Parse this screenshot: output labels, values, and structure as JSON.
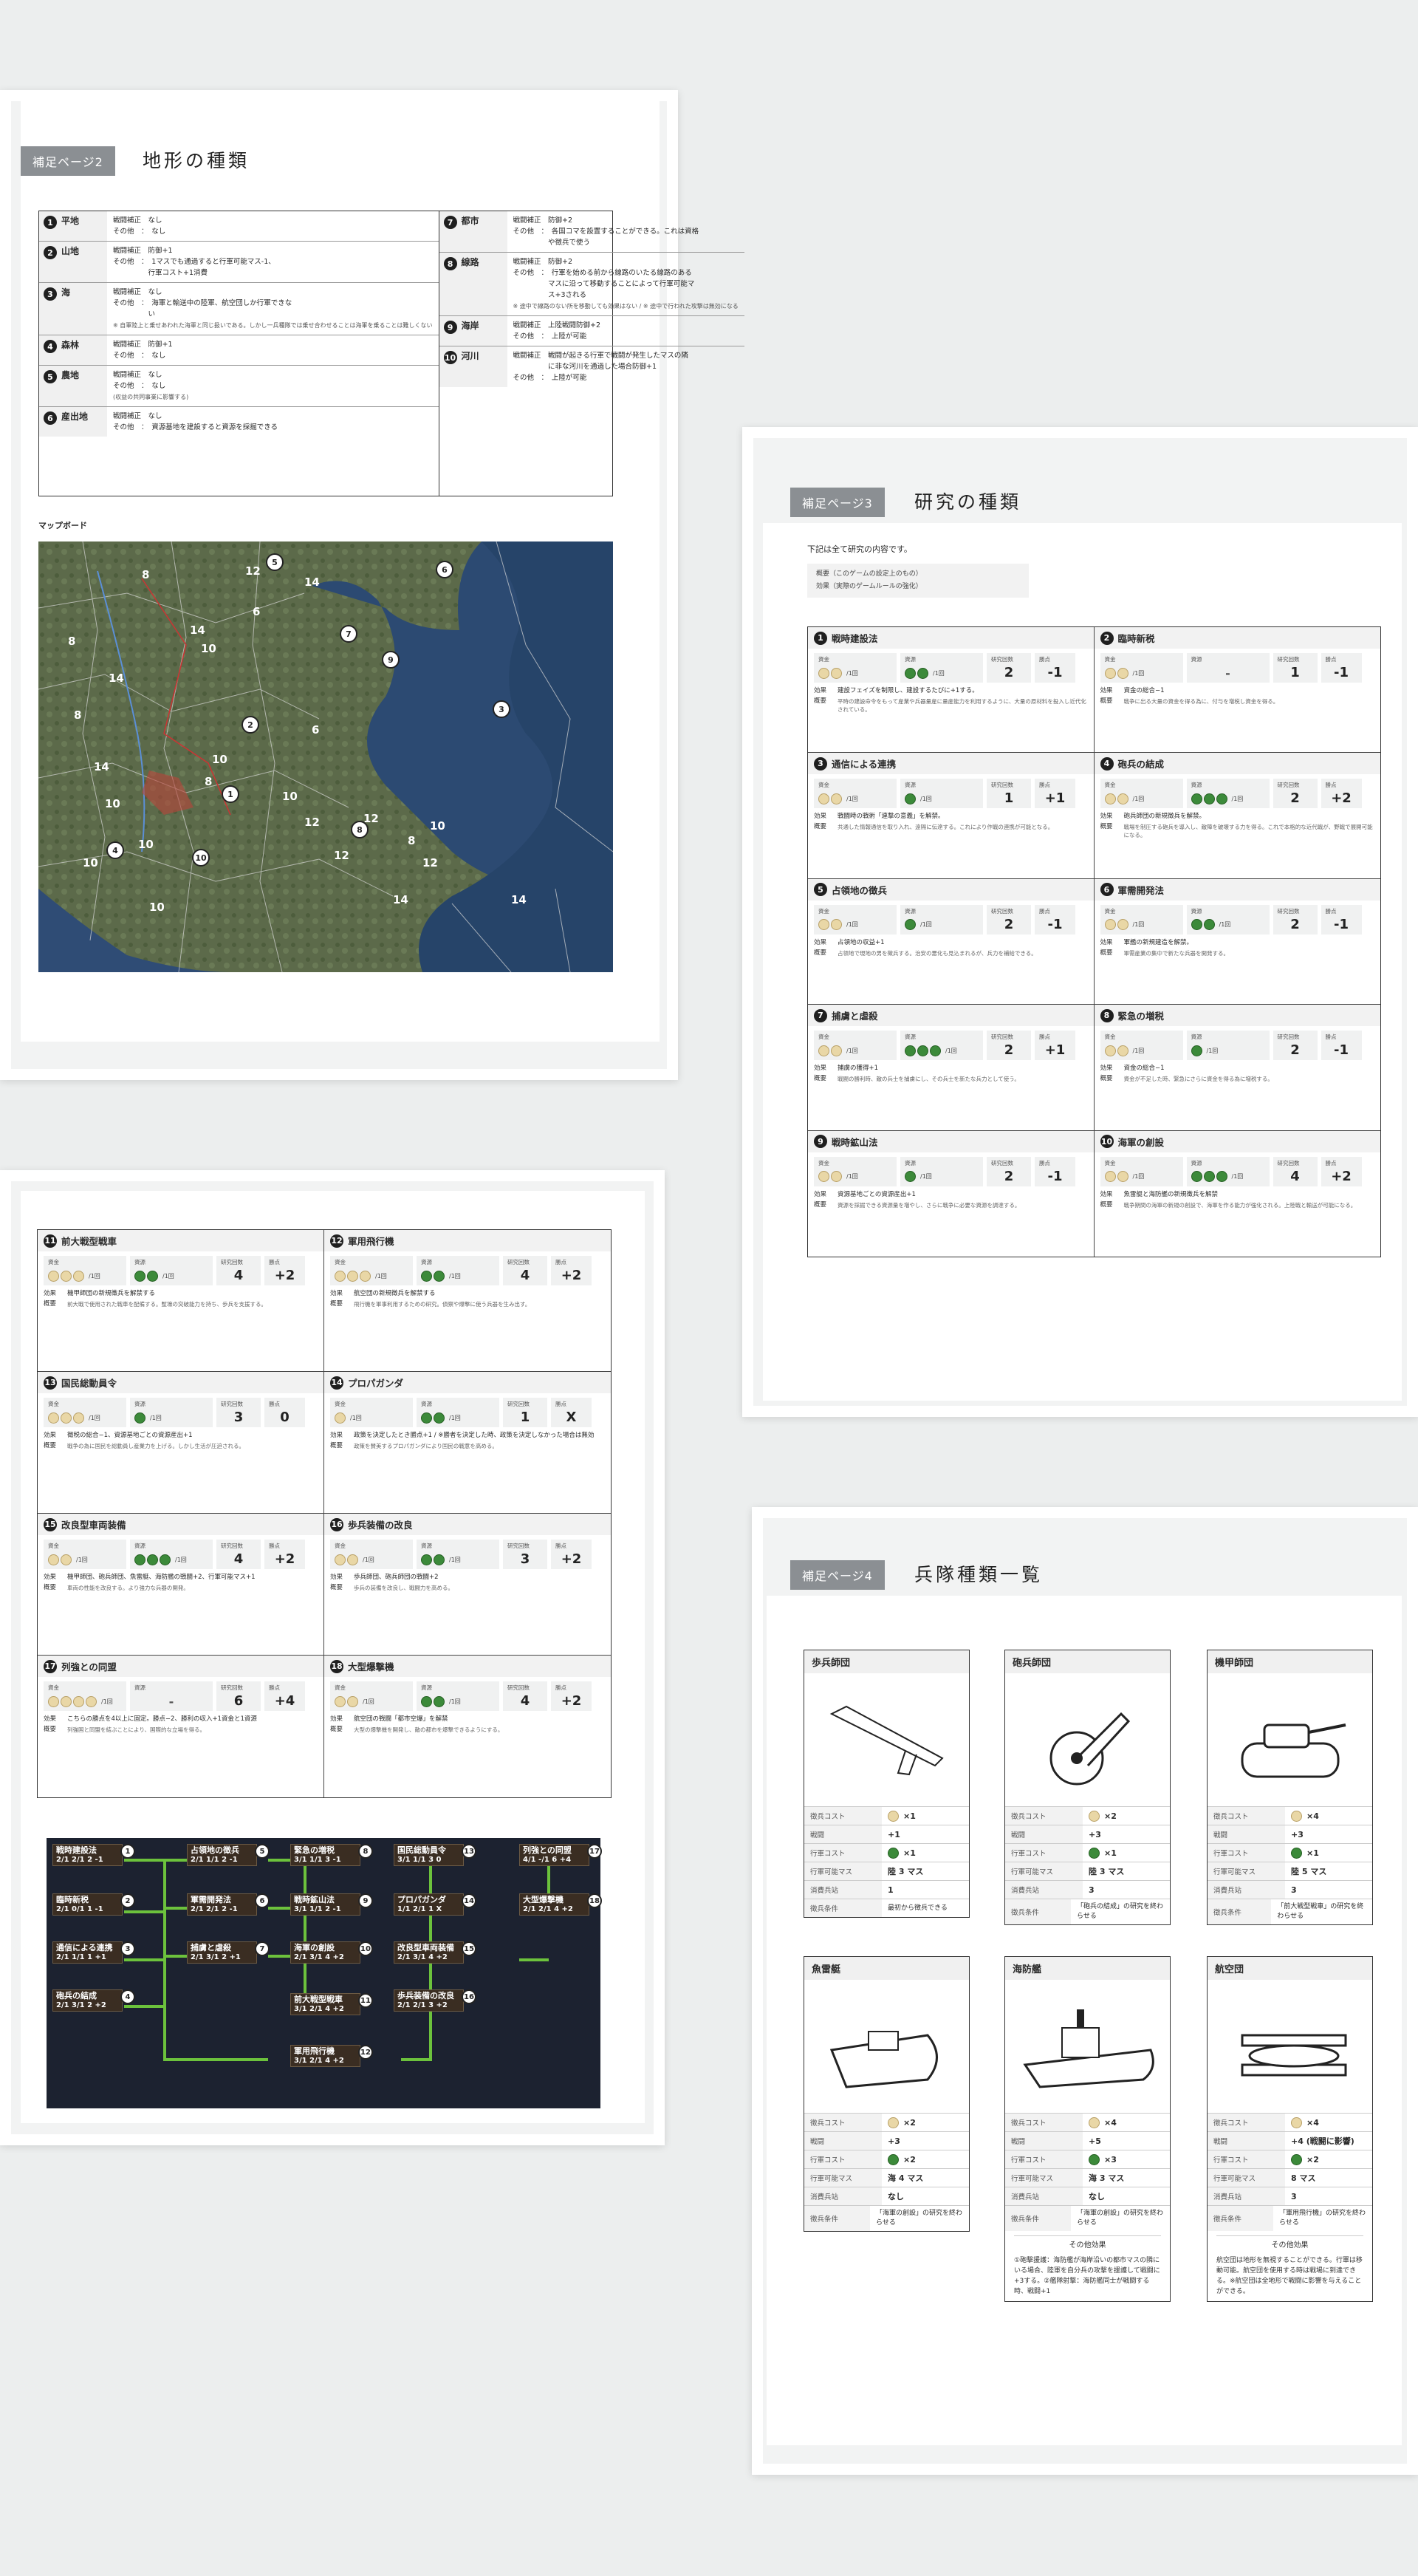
{
  "p2": {
    "badge": "補足ページ2",
    "title": "地形の種類",
    "terrain_left": [
      {
        "num": "1",
        "name": "平地",
        "lines": [
          "戦闘補正　なし",
          "その他　：　なし"
        ]
      },
      {
        "num": "2",
        "name": "山地",
        "lines": [
          "戦闘補正　防御+1",
          "その他　：　1マスでも通過すると行軍可能マス-1、",
          "　　　　　行軍コスト+1消費"
        ]
      },
      {
        "num": "3",
        "name": "海",
        "lines": [
          "戦闘補正　なし",
          "その他　：　海軍と輸送中の陸軍、航空団しか行軍できな",
          "　　　　　い"
        ],
        "note": "※ 自軍陸上と乗せあわれた海軍と同じ扱いである。しかし一兵種隊では乗せ合わせることは海軍を乗ることは難しくない"
      },
      {
        "num": "4",
        "name": "森林",
        "lines": [
          "戦闘補正　防御+1",
          "その他　：　なし"
        ]
      },
      {
        "num": "5",
        "name": "農地",
        "lines": [
          "戦闘補正　なし",
          "その他　：　なし"
        ],
        "note": "(収益の共同事業に影響する)"
      },
      {
        "num": "6",
        "name": "産出地",
        "lines": [
          "戦闘補正　なし",
          "その他　：　資源基地を建設すると資源を採掘できる"
        ]
      }
    ],
    "terrain_right": [
      {
        "num": "7",
        "name": "都市",
        "lines": [
          "戦闘補正　防御+2",
          "その他　：　各国コマを設置することができる。これは資格",
          "　　　　　や徴兵で使う"
        ]
      },
      {
        "num": "8",
        "name": "線路",
        "lines": [
          "戦闘補正　防御+2",
          "その他　：　行軍を始める前から線路のいたる線路のある",
          "　　　　　マスに沿って移動することによって行軍可能マ",
          "　　　　　ス+3される"
        ],
        "note": "※ 途中で線路のない所を移動しても効果はない / ※ 途中で行われた攻撃は無効になる"
      },
      {
        "num": "9",
        "name": "海岸",
        "lines": [
          "戦闘補正　上陸戦闘防御+2",
          "その他　：　上陸が可能"
        ]
      },
      {
        "num": "10",
        "name": "河川",
        "lines": [
          "戦闘補正　戦闘が起きる行軍で戦闘が発生したマスの隣",
          "　　　　　に非な河川を通過した場合防御+1",
          "その他　：　上陸が可能"
        ]
      }
    ],
    "map_label": "マップボード",
    "map_markers": [
      "1",
      "2",
      "3",
      "4",
      "5",
      "6",
      "7",
      "8",
      "9",
      "10"
    ],
    "map_numbers": [
      "8",
      "12",
      "6",
      "14",
      "14",
      "8",
      "10",
      "14",
      "8",
      "6",
      "10",
      "14",
      "8",
      "10",
      "10",
      "12",
      "12",
      "10",
      "8",
      "10",
      "12",
      "10",
      "12",
      "14",
      "10",
      "14"
    ]
  },
  "p3": {
    "badge": "補足ページ3",
    "title": "研究の種類",
    "intro": "下記は全て研究の内容です。",
    "legend": [
      "概要（このゲームの設定上のもの）",
      "効果（実際のゲームルールの強化）"
    ],
    "labels": {
      "fund": "資金",
      "resource": "資源",
      "turns": "研究回数",
      "vp": "勝点",
      "per": "/1回",
      "effect": "効果",
      "overview": "概要"
    },
    "items": [
      {
        "num": "1",
        "name": "戦時建設法",
        "coins": 2,
        "gems": 2,
        "turns": "2",
        "vp": "-1",
        "effect": "建設フェイズを制限し、建設するたびに+1する。",
        "overview": "平時の建設命令をもって産業や兵器量産に量産能力を利用するように、大量の原材料を投入し近代化されている。"
      },
      {
        "num": "2",
        "name": "臨時新税",
        "coins": 2,
        "gems": 0,
        "res_text": "-",
        "turns": "1",
        "vp": "-1",
        "effect": "資金の総合−1",
        "overview": "戦争に出る大量の資金を得る為に、付与を増税し資金を得る。"
      },
      {
        "num": "3",
        "name": "通信による連携",
        "coins": 2,
        "gems": 1,
        "turns": "1",
        "vp": "+1",
        "effect": "戦闘時の戦術「連撃の意義」を解禁。",
        "overview": "共通した情報通信を取り入れ、遠隔に伝達する。これにより作戦の連携が可能となる。"
      },
      {
        "num": "4",
        "name": "砲兵の結成",
        "coins": 2,
        "gems": 3,
        "turns": "2",
        "vp": "+2",
        "effect": "砲兵師団の新規徴兵を解禁。",
        "overview": "戦場を制圧する砲兵を導入し、敵陣を破壊する力を得る。これで本格的な近代戦が、野戦で展開可能になる。"
      },
      {
        "num": "5",
        "name": "占領地の徴兵",
        "coins": 2,
        "gems": 1,
        "turns": "2",
        "vp": "-1",
        "effect": "占領地の収益+1",
        "overview": "占領地で現地の男を徴兵する。治安の悪化も見込まれるが、兵力を補給できる。"
      },
      {
        "num": "6",
        "name": "軍需開発法",
        "coins": 2,
        "gems": 2,
        "turns": "2",
        "vp": "-1",
        "effect": "軍艦の新規建造を解禁。",
        "overview": "軍需産業の集中で新たな兵器を開発する。"
      },
      {
        "num": "7",
        "name": "捕虜と虐殺",
        "coins": 2,
        "gems": 3,
        "turns": "2",
        "vp": "+1",
        "effect": "捕虜の獲得+1",
        "overview": "戦闘の勝利時、敵の兵士を捕虜にし、その兵士を新たな兵力として使う。"
      },
      {
        "num": "8",
        "name": "緊急の増税",
        "coins": 2,
        "gems": 1,
        "turns": "2",
        "vp": "-1",
        "effect": "資金の総合−1",
        "overview": "資金が不足した時、緊急にさらに資金を得る為に増税する。"
      },
      {
        "num": "9",
        "name": "戦時鉱山法",
        "coins": 2,
        "gems": 1,
        "turns": "2",
        "vp": "-1",
        "effect": "資源基地ごとの資源産出+1",
        "overview": "資源を採掘できる資源量を増やし、さらに戦争に必要な資源を調達する。"
      },
      {
        "num": "10",
        "name": "海軍の創設",
        "coins": 2,
        "gems": 3,
        "turns": "4",
        "vp": "+2",
        "effect": "魚雷艇と海防艦の新規徴兵を解禁",
        "overview": "戦争期間の海軍の新規の創設で、海軍を作る能力が強化される。上陸戦と輸送が可能になる。"
      }
    ]
  },
  "p5": {
    "items": [
      {
        "num": "11",
        "name": "前大戦型戦車",
        "coins": 3,
        "gems": 2,
        "turns": "4",
        "vp": "+2",
        "effect": "機甲師団の新規徴兵を解禁する",
        "overview": "前大戦で使用された戦車を配備する。塹壕の突破能力を持ち、歩兵を支援する。"
      },
      {
        "num": "12",
        "name": "軍用飛行機",
        "coins": 3,
        "gems": 2,
        "turns": "4",
        "vp": "+2",
        "effect": "航空団の新規徴兵を解禁する",
        "overview": "飛行機を軍事利用するための研究。偵察や爆撃に使う兵器を生み出す。"
      },
      {
        "num": "13",
        "name": "国民総動員令",
        "coins": 3,
        "gems": 1,
        "turns": "3",
        "vp": "0",
        "effect": "徴税の総合−1、資源基地ごとの資源産出+1",
        "overview": "戦争の為に国民を総動員し産業力を上げる。しかし生活が圧迫される。"
      },
      {
        "num": "14",
        "name": "プロパガンダ",
        "coins": 1,
        "gems": 2,
        "turns": "1",
        "vp": "X",
        "effect": "政策を決定したとき勝点+1 / ※勝者を決定した時、政策を決定しなかった場合は無効",
        "overview": "政策を賛美するプロパガンダにより国民の戦意を高める。"
      },
      {
        "num": "15",
        "name": "改良型車両装備",
        "coins": 2,
        "gems": 3,
        "turns": "4",
        "vp": "+2",
        "effect": "機甲師団、砲兵師団、魚雷艇、海防艦の戦闘+2、行軍可能マス+1",
        "overview": "車両の性能を改良する。より強力な兵器の開発。"
      },
      {
        "num": "16",
        "name": "歩兵装備の改良",
        "coins": 2,
        "gems": 2,
        "turns": "3",
        "vp": "+2",
        "effect": "歩兵師団、砲兵師団の戦闘+2",
        "overview": "歩兵の装備を改良し、戦闘力を高める。"
      },
      {
        "num": "17",
        "name": "列強との同盟",
        "coins": 4,
        "gems": 0,
        "res_text": "-",
        "turns": "6",
        "vp": "+4",
        "effect": "こちらの勝点を4以上に固定。勝点−2、勝利の収入+1資金と1資源",
        "overview": "列強国と同盟を結ぶことにより、国際的な立場を得る。"
      },
      {
        "num": "18",
        "name": "大型爆撃機",
        "coins": 2,
        "gems": 2,
        "turns": "4",
        "vp": "+2",
        "effect": "航空団の戦闘「都市空爆」を解禁",
        "overview": "大型の爆撃機を開発し、敵の都市を爆撃できるようにする。"
      }
    ],
    "tree": [
      {
        "num": "1",
        "name": "戦時建設法",
        "stats": "2/1 2/1 2 -1"
      },
      {
        "num": "2",
        "name": "臨時新税",
        "stats": "2/1 0/1 1 -1"
      },
      {
        "num": "3",
        "name": "通信による連携",
        "stats": "2/1 1/1 1 +1"
      },
      {
        "num": "4",
        "name": "砲兵の結成",
        "stats": "2/1 3/1 2 +2"
      },
      {
        "num": "5",
        "name": "占領地の徴兵",
        "stats": "2/1 1/1 2 -1"
      },
      {
        "num": "6",
        "name": "軍需開発法",
        "stats": "2/1 2/1 2 -1"
      },
      {
        "num": "7",
        "name": "捕虜と虐殺",
        "stats": "2/1 3/1 2 +1"
      },
      {
        "num": "8",
        "name": "緊急の増税",
        "stats": "3/1 1/1 3 -1"
      },
      {
        "num": "9",
        "name": "戦時鉱山法",
        "stats": "3/1 1/1 2 -1"
      },
      {
        "num": "10",
        "name": "海軍の創設",
        "stats": "2/1 3/1 4 +2"
      },
      {
        "num": "11",
        "name": "前大戦型戦車",
        "stats": "3/1 2/1 4 +2"
      },
      {
        "num": "12",
        "name": "軍用飛行機",
        "stats": "3/1 2/1 4 +2"
      },
      {
        "num": "13",
        "name": "国民総動員令",
        "stats": "3/1 1/1 3 0"
      },
      {
        "num": "14",
        "name": "プロパガンダ",
        "stats": "1/1 2/1 1 X"
      },
      {
        "num": "15",
        "name": "改良型車両装備",
        "stats": "2/1 3/1 4 +2"
      },
      {
        "num": "16",
        "name": "歩兵装備の改良",
        "stats": "2/1 2/1 3 +2"
      },
      {
        "num": "17",
        "name": "列強との同盟",
        "stats": "4/1 -/1 6 +4"
      },
      {
        "num": "18",
        "name": "大型爆撃機",
        "stats": "2/1 2/1 4 +2"
      }
    ]
  },
  "p4": {
    "badge": "補足ページ4",
    "title": "兵隊種類一覧",
    "row_keys": [
      "徴兵コスト",
      "戦闘",
      "行軍コスト",
      "行軍可能マス",
      "消費兵站",
      "徴兵条件"
    ],
    "units": [
      {
        "name": "歩兵師団",
        "icon": "rifle-icon",
        "cost": "×1",
        "battle": "+1",
        "march_cost": "×1",
        "march": "陸 3 マス",
        "supply": "1",
        "cond": "最初から徴兵できる"
      },
      {
        "name": "砲兵師団",
        "icon": "cannon-icon",
        "cost": "×2",
        "battle": "+3",
        "march_cost": "×1",
        "march": "陸 3 マス",
        "supply": "3",
        "cond": "「砲兵の結成」の研究を終わらせる"
      },
      {
        "name": "機甲師団",
        "icon": "tank-icon",
        "cost": "×4",
        "battle": "+3",
        "march_cost": "×1",
        "march": "陸 5 マス",
        "supply": "3",
        "cond": "「前大戦型戦車」の研究を終わらせる"
      },
      {
        "name": "魚雷艇",
        "icon": "torpedo-boat-icon",
        "cost": "×2",
        "battle": "+3",
        "march_cost": "×2",
        "march": "海 4 マス",
        "supply": "なし",
        "cond": "「海軍の創設」の研究を終わらせる"
      },
      {
        "name": "海防艦",
        "icon": "coastal-ship-icon",
        "cost": "×4",
        "battle": "+5",
        "march_cost": "×3",
        "march": "海 3 マス",
        "supply": "なし",
        "cond": "「海軍の創設」の研究を終わらせる",
        "other_title": "その他効果",
        "other": "①砲撃援護：海防艦が海岸沿いの都市マスの隣にいる場合、陸軍を自分兵の攻撃を援護して戦闘に+3する。②艦隊射撃：海防艦同士が戦闘する時、戦闘+1"
      },
      {
        "name": "航空団",
        "icon": "biplane-icon",
        "cost": "×4",
        "battle": "+4 (戦闘に影響)",
        "march_cost": "×2",
        "march": "8 マス",
        "supply": "3",
        "cond": "「軍用飛行機」の研究を終わらせる",
        "other_title": "その他効果",
        "other": "航空団は地形を無視することができる。行軍は移動可能。航空団を使用する時は戦場に到達できる。※航空団は全地形で戦闘に影響を与えることができる。"
      }
    ]
  }
}
